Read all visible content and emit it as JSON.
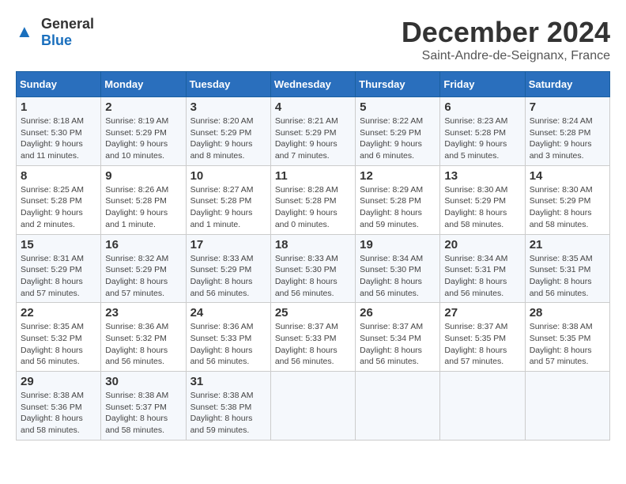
{
  "logo": {
    "general": "General",
    "blue": "Blue"
  },
  "title": "December 2024",
  "subtitle": "Saint-Andre-de-Seignanx, France",
  "headers": [
    "Sunday",
    "Monday",
    "Tuesday",
    "Wednesday",
    "Thursday",
    "Friday",
    "Saturday"
  ],
  "weeks": [
    [
      {
        "day": "1",
        "info": "Sunrise: 8:18 AM\nSunset: 5:30 PM\nDaylight: 9 hours\nand 11 minutes."
      },
      {
        "day": "2",
        "info": "Sunrise: 8:19 AM\nSunset: 5:29 PM\nDaylight: 9 hours\nand 10 minutes."
      },
      {
        "day": "3",
        "info": "Sunrise: 8:20 AM\nSunset: 5:29 PM\nDaylight: 9 hours\nand 8 minutes."
      },
      {
        "day": "4",
        "info": "Sunrise: 8:21 AM\nSunset: 5:29 PM\nDaylight: 9 hours\nand 7 minutes."
      },
      {
        "day": "5",
        "info": "Sunrise: 8:22 AM\nSunset: 5:29 PM\nDaylight: 9 hours\nand 6 minutes."
      },
      {
        "day": "6",
        "info": "Sunrise: 8:23 AM\nSunset: 5:28 PM\nDaylight: 9 hours\nand 5 minutes."
      },
      {
        "day": "7",
        "info": "Sunrise: 8:24 AM\nSunset: 5:28 PM\nDaylight: 9 hours\nand 3 minutes."
      }
    ],
    [
      {
        "day": "8",
        "info": "Sunrise: 8:25 AM\nSunset: 5:28 PM\nDaylight: 9 hours\nand 2 minutes."
      },
      {
        "day": "9",
        "info": "Sunrise: 8:26 AM\nSunset: 5:28 PM\nDaylight: 9 hours\nand 1 minute."
      },
      {
        "day": "10",
        "info": "Sunrise: 8:27 AM\nSunset: 5:28 PM\nDaylight: 9 hours\nand 1 minute."
      },
      {
        "day": "11",
        "info": "Sunrise: 8:28 AM\nSunset: 5:28 PM\nDaylight: 9 hours\nand 0 minutes."
      },
      {
        "day": "12",
        "info": "Sunrise: 8:29 AM\nSunset: 5:28 PM\nDaylight: 8 hours\nand 59 minutes."
      },
      {
        "day": "13",
        "info": "Sunrise: 8:30 AM\nSunset: 5:29 PM\nDaylight: 8 hours\nand 58 minutes."
      },
      {
        "day": "14",
        "info": "Sunrise: 8:30 AM\nSunset: 5:29 PM\nDaylight: 8 hours\nand 58 minutes."
      }
    ],
    [
      {
        "day": "15",
        "info": "Sunrise: 8:31 AM\nSunset: 5:29 PM\nDaylight: 8 hours\nand 57 minutes."
      },
      {
        "day": "16",
        "info": "Sunrise: 8:32 AM\nSunset: 5:29 PM\nDaylight: 8 hours\nand 57 minutes."
      },
      {
        "day": "17",
        "info": "Sunrise: 8:33 AM\nSunset: 5:29 PM\nDaylight: 8 hours\nand 56 minutes."
      },
      {
        "day": "18",
        "info": "Sunrise: 8:33 AM\nSunset: 5:30 PM\nDaylight: 8 hours\nand 56 minutes."
      },
      {
        "day": "19",
        "info": "Sunrise: 8:34 AM\nSunset: 5:30 PM\nDaylight: 8 hours\nand 56 minutes."
      },
      {
        "day": "20",
        "info": "Sunrise: 8:34 AM\nSunset: 5:31 PM\nDaylight: 8 hours\nand 56 minutes."
      },
      {
        "day": "21",
        "info": "Sunrise: 8:35 AM\nSunset: 5:31 PM\nDaylight: 8 hours\nand 56 minutes."
      }
    ],
    [
      {
        "day": "22",
        "info": "Sunrise: 8:35 AM\nSunset: 5:32 PM\nDaylight: 8 hours\nand 56 minutes."
      },
      {
        "day": "23",
        "info": "Sunrise: 8:36 AM\nSunset: 5:32 PM\nDaylight: 8 hours\nand 56 minutes."
      },
      {
        "day": "24",
        "info": "Sunrise: 8:36 AM\nSunset: 5:33 PM\nDaylight: 8 hours\nand 56 minutes."
      },
      {
        "day": "25",
        "info": "Sunrise: 8:37 AM\nSunset: 5:33 PM\nDaylight: 8 hours\nand 56 minutes."
      },
      {
        "day": "26",
        "info": "Sunrise: 8:37 AM\nSunset: 5:34 PM\nDaylight: 8 hours\nand 56 minutes."
      },
      {
        "day": "27",
        "info": "Sunrise: 8:37 AM\nSunset: 5:35 PM\nDaylight: 8 hours\nand 57 minutes."
      },
      {
        "day": "28",
        "info": "Sunrise: 8:38 AM\nSunset: 5:35 PM\nDaylight: 8 hours\nand 57 minutes."
      }
    ],
    [
      {
        "day": "29",
        "info": "Sunrise: 8:38 AM\nSunset: 5:36 PM\nDaylight: 8 hours\nand 58 minutes."
      },
      {
        "day": "30",
        "info": "Sunrise: 8:38 AM\nSunset: 5:37 PM\nDaylight: 8 hours\nand 58 minutes."
      },
      {
        "day": "31",
        "info": "Sunrise: 8:38 AM\nSunset: 5:38 PM\nDaylight: 8 hours\nand 59 minutes."
      },
      {
        "day": "",
        "info": ""
      },
      {
        "day": "",
        "info": ""
      },
      {
        "day": "",
        "info": ""
      },
      {
        "day": "",
        "info": ""
      }
    ]
  ]
}
